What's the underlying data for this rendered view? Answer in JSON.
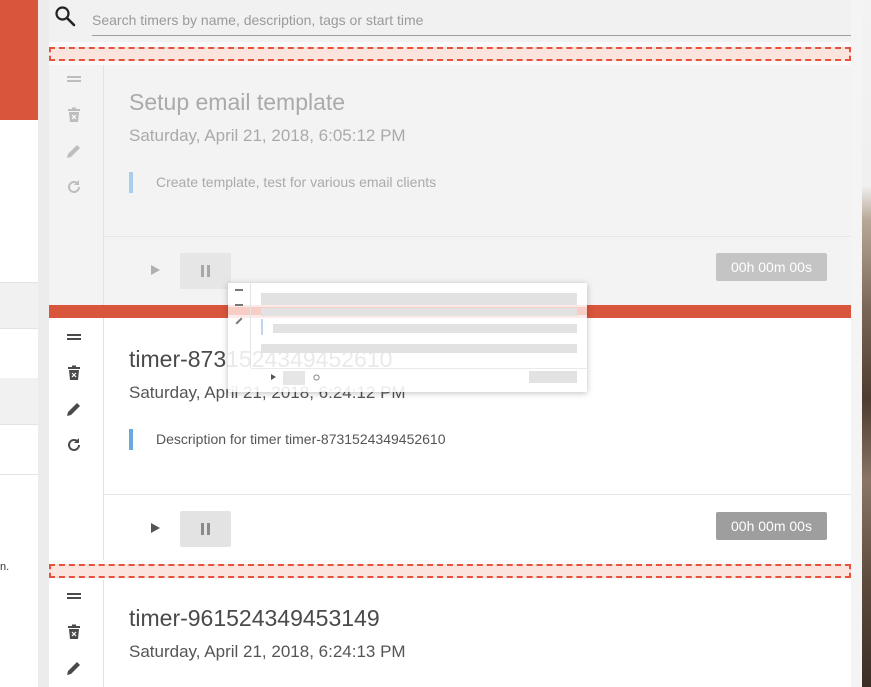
{
  "search": {
    "placeholder": "Search timers by name, description, tags or start time"
  },
  "background_fragment": "n.",
  "timers": [
    {
      "title": "Setup email template",
      "start_time": "Saturday, April 21, 2018, 6:05:12 PM",
      "description": "Create template, test for various email clients",
      "elapsed": "00h 00m 00s",
      "state": "being-dragged"
    },
    {
      "title": "timer-8731524349452610",
      "start_time": "Saturday, April 21, 2018, 6:24:12 PM",
      "description": "Description for timer timer-8731524349452610",
      "elapsed": "00h 00m 00s"
    },
    {
      "title": "timer-961524349453149",
      "start_time": "Saturday, April 21, 2018, 6:24:13 PM"
    }
  ],
  "icons": {
    "drag": "drag-handle-icon",
    "delete": "delete-icon",
    "edit": "edit-icon",
    "reset": "reset-icon",
    "play": "play-icon",
    "pause": "pause-icon",
    "search": "search-icon"
  },
  "colors": {
    "accent": "#d9553c",
    "description_bar": "#6aa9df",
    "counter": "#9e9e9e"
  }
}
